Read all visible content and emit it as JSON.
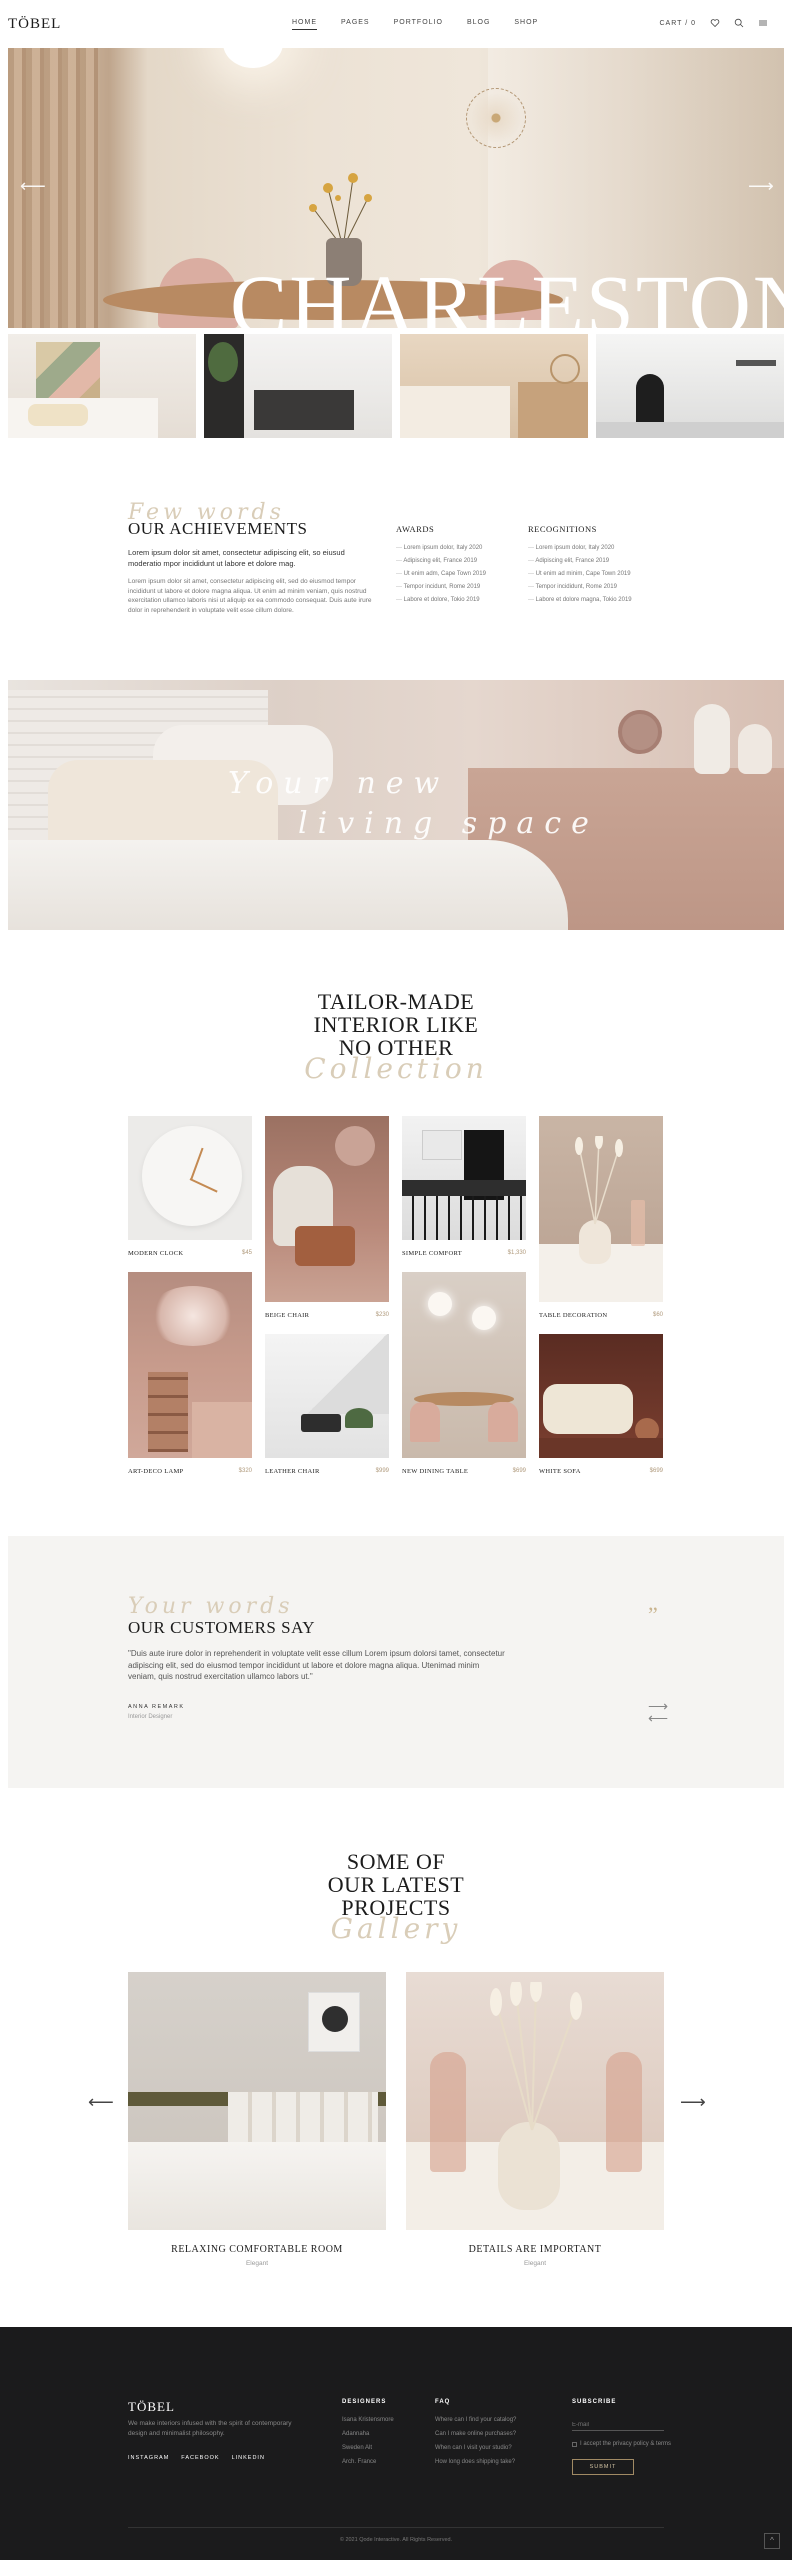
{
  "header": {
    "logo": "TÖBEL",
    "nav": [
      "HOME",
      "PAGES",
      "PORTFOLIO",
      "BLOG",
      "SHOP"
    ],
    "cart": "CART / 0"
  },
  "hero": {
    "title": "CHARLESTON"
  },
  "achievements": {
    "script": "Few words",
    "title": "OUR ACHIEVEMENTS",
    "lead": "Lorem ipsum dolor sit amet, consectetur adipiscing elit, so eiusud moderatio mpor incididunt ut labore et dolore mag.",
    "body": "Lorem ipsum dolor sit amet, consectetur adipiscing elit, sed do eiusmod tempor incididunt ut labore et dolore magna aliqua. Ut enim ad minim veniam, quis nostrud exercitation ullamco laboris nisi ut aliquip ex ea commodo consequat. Duis aute irure dolor in reprehenderit in voluptate velit esse cillum dolore.",
    "awards_title": "AWARDS",
    "awards": [
      "Lorem ipsum dolor, Italy 2020",
      "Adipiscing elit, France 2019",
      "Ut enim adm, Cape Town 2019",
      "Tempor incidunt, Rome 2019",
      "Labore et dolore, Tokio 2019"
    ],
    "recognitions_title": "RECOGNITIONS",
    "recognitions": [
      "Lorem ipsum dolor, Italy 2020",
      "Adipiscing elit, France 2019",
      "Ut enim ad minim, Cape Town 2019",
      "Tempor incididunt, Rome 2019",
      "Labore et dolore magna, Tokio 2019"
    ]
  },
  "living": {
    "line1": "Your new",
    "line2": "living space"
  },
  "collection": {
    "title_lines": [
      "TAILOR-MADE",
      "INTERIOR LIKE",
      "NO OTHER"
    ],
    "script": "Collection",
    "products": [
      {
        "name": "MODERN CLOCK",
        "price": "$45"
      },
      {
        "name": "BEIGE CHAIR",
        "price": "$230"
      },
      {
        "name": "SIMPLE COMFORT",
        "price": "$1,330"
      },
      {
        "name": "TABLE DECORATION",
        "price": "$60"
      },
      {
        "name": "ART-DECO LAMP",
        "price": "$320"
      },
      {
        "name": "LEATHER CHAIR",
        "price": "$999"
      },
      {
        "name": "NEW DINING TABLE",
        "price": "$699"
      },
      {
        "name": "WHITE SOFA",
        "price": "$699"
      }
    ]
  },
  "customers": {
    "script": "Your words",
    "title": "OUR CUSTOMERS SAY",
    "quote": "\"Duis aute irure dolor in reprehenderit in voluptate velit esse cillum Lorem ipsum dolorsi tamet, consectetur adipiscing elit, sed do eiusmod tempor incididunt ut labore et dolore magna aliqua. Utenimad minim veniam, quis nostrud exercitation ullamco labors ut.\"",
    "name": "ANNA REMARK",
    "role": "Interior Designer",
    "quote_mark": "”"
  },
  "projects": {
    "title_lines": [
      "SOME OF",
      "OUR LATEST",
      "PROJECTS"
    ],
    "script": "Gallery",
    "items": [
      {
        "name": "RELAXING COMFORTABLE ROOM",
        "category": "Elegant"
      },
      {
        "name": "DETAILS ARE IMPORTANT",
        "category": "Elegant"
      }
    ]
  },
  "footer": {
    "logo": "TÖBEL",
    "description": "We make interiors infused with the spirit of contemporary design and minimalist philosophy.",
    "social": [
      "INSTAGRAM",
      "FACEBOOK",
      "LINKEDIN"
    ],
    "designers_title": "DESIGNERS",
    "designers": [
      "Isana Kristensmore",
      "Adannaha",
      "Sweden Alt",
      "Arch. France"
    ],
    "faq_title": "FAQ",
    "faq": [
      "Where can I find your catalog?",
      "Can I make online purchases?",
      "When can I visit your studio?",
      "How long does shipping take?"
    ],
    "subscribe_title": "SUBSCRIBE",
    "email_placeholder": "E-mail",
    "checkbox_label": "I accept the privacy policy & terms",
    "submit": "SUBMIT",
    "copyright": "© 2021 Qode Interactive. All Rights Reserved.",
    "back_to_top": "^"
  },
  "colors": {
    "accent": "#b09a7c",
    "script": "#d9cdb8",
    "footer_bg": "#1b1b1c"
  }
}
